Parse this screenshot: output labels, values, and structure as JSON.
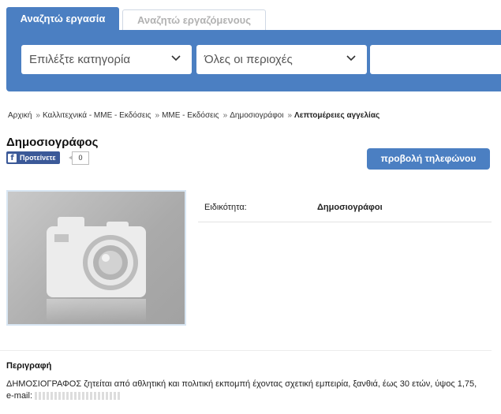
{
  "tabs": [
    {
      "label": "Αναζητώ εργασία",
      "active": true
    },
    {
      "label": "Αναζητώ εργαζόμενους",
      "active": false
    }
  ],
  "search": {
    "category_placeholder": "Επιλέξτε κατηγορία",
    "region_placeholder": "Όλες οι περιοχές",
    "keyword_value": ""
  },
  "breadcrumb": [
    "Αρχική",
    "Καλλιτεχνικά - ΜΜΕ - Εκδόσεις",
    "ΜΜΕ - Εκδόσεις",
    "Δημοσιογράφοι"
  ],
  "breadcrumb_current": "Λεπτομέρειες αγγελίας",
  "listing": {
    "title": "Δημοσιογράφος",
    "fb_like_label": "Προτείνετε",
    "fb_like_count": "0",
    "phone_button": "προβολή τηλεφώνου",
    "spec_label": "Ειδικότητα:",
    "spec_value": "Δημοσιογράφοι",
    "description_heading": "Περιγραφή",
    "description_text": "ΔΗΜΟΣΙΟΓΡΑΦΟΣ ζητείται από αθλητική και πολιτική εκπομπή έχοντας σχετική εμπειρία, ξανθιά, έως 30 ετών, ύψος 1,75, e-mail:"
  },
  "icons": [
    "chevron-down-icon",
    "facebook-icon",
    "camera-placeholder-icon"
  ],
  "colors": {
    "accent": "#4b7fc2",
    "facebook": "#3b5998"
  }
}
